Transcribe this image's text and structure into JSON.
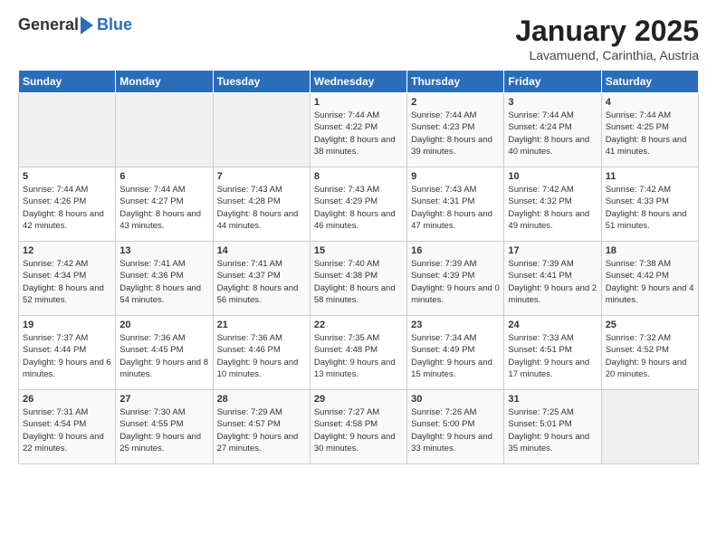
{
  "header": {
    "logo_general": "General",
    "logo_blue": "Blue",
    "title": "January 2025",
    "subtitle": "Lavamuend, Carinthia, Austria"
  },
  "calendar": {
    "headers": [
      "Sunday",
      "Monday",
      "Tuesday",
      "Wednesday",
      "Thursday",
      "Friday",
      "Saturday"
    ],
    "rows": [
      [
        {
          "day": "",
          "text": ""
        },
        {
          "day": "",
          "text": ""
        },
        {
          "day": "",
          "text": ""
        },
        {
          "day": "1",
          "text": "Sunrise: 7:44 AM\nSunset: 4:22 PM\nDaylight: 8 hours and 38 minutes."
        },
        {
          "day": "2",
          "text": "Sunrise: 7:44 AM\nSunset: 4:23 PM\nDaylight: 8 hours and 39 minutes."
        },
        {
          "day": "3",
          "text": "Sunrise: 7:44 AM\nSunset: 4:24 PM\nDaylight: 8 hours and 40 minutes."
        },
        {
          "day": "4",
          "text": "Sunrise: 7:44 AM\nSunset: 4:25 PM\nDaylight: 8 hours and 41 minutes."
        }
      ],
      [
        {
          "day": "5",
          "text": "Sunrise: 7:44 AM\nSunset: 4:26 PM\nDaylight: 8 hours and 42 minutes."
        },
        {
          "day": "6",
          "text": "Sunrise: 7:44 AM\nSunset: 4:27 PM\nDaylight: 8 hours and 43 minutes."
        },
        {
          "day": "7",
          "text": "Sunrise: 7:43 AM\nSunset: 4:28 PM\nDaylight: 8 hours and 44 minutes."
        },
        {
          "day": "8",
          "text": "Sunrise: 7:43 AM\nSunset: 4:29 PM\nDaylight: 8 hours and 46 minutes."
        },
        {
          "day": "9",
          "text": "Sunrise: 7:43 AM\nSunset: 4:31 PM\nDaylight: 8 hours and 47 minutes."
        },
        {
          "day": "10",
          "text": "Sunrise: 7:42 AM\nSunset: 4:32 PM\nDaylight: 8 hours and 49 minutes."
        },
        {
          "day": "11",
          "text": "Sunrise: 7:42 AM\nSunset: 4:33 PM\nDaylight: 8 hours and 51 minutes."
        }
      ],
      [
        {
          "day": "12",
          "text": "Sunrise: 7:42 AM\nSunset: 4:34 PM\nDaylight: 8 hours and 52 minutes."
        },
        {
          "day": "13",
          "text": "Sunrise: 7:41 AM\nSunset: 4:36 PM\nDaylight: 8 hours and 54 minutes."
        },
        {
          "day": "14",
          "text": "Sunrise: 7:41 AM\nSunset: 4:37 PM\nDaylight: 8 hours and 56 minutes."
        },
        {
          "day": "15",
          "text": "Sunrise: 7:40 AM\nSunset: 4:38 PM\nDaylight: 8 hours and 58 minutes."
        },
        {
          "day": "16",
          "text": "Sunrise: 7:39 AM\nSunset: 4:39 PM\nDaylight: 9 hours and 0 minutes."
        },
        {
          "day": "17",
          "text": "Sunrise: 7:39 AM\nSunset: 4:41 PM\nDaylight: 9 hours and 2 minutes."
        },
        {
          "day": "18",
          "text": "Sunrise: 7:38 AM\nSunset: 4:42 PM\nDaylight: 9 hours and 4 minutes."
        }
      ],
      [
        {
          "day": "19",
          "text": "Sunrise: 7:37 AM\nSunset: 4:44 PM\nDaylight: 9 hours and 6 minutes."
        },
        {
          "day": "20",
          "text": "Sunrise: 7:36 AM\nSunset: 4:45 PM\nDaylight: 9 hours and 8 minutes."
        },
        {
          "day": "21",
          "text": "Sunrise: 7:36 AM\nSunset: 4:46 PM\nDaylight: 9 hours and 10 minutes."
        },
        {
          "day": "22",
          "text": "Sunrise: 7:35 AM\nSunset: 4:48 PM\nDaylight: 9 hours and 13 minutes."
        },
        {
          "day": "23",
          "text": "Sunrise: 7:34 AM\nSunset: 4:49 PM\nDaylight: 9 hours and 15 minutes."
        },
        {
          "day": "24",
          "text": "Sunrise: 7:33 AM\nSunset: 4:51 PM\nDaylight: 9 hours and 17 minutes."
        },
        {
          "day": "25",
          "text": "Sunrise: 7:32 AM\nSunset: 4:52 PM\nDaylight: 9 hours and 20 minutes."
        }
      ],
      [
        {
          "day": "26",
          "text": "Sunrise: 7:31 AM\nSunset: 4:54 PM\nDaylight: 9 hours and 22 minutes."
        },
        {
          "day": "27",
          "text": "Sunrise: 7:30 AM\nSunset: 4:55 PM\nDaylight: 9 hours and 25 minutes."
        },
        {
          "day": "28",
          "text": "Sunrise: 7:29 AM\nSunset: 4:57 PM\nDaylight: 9 hours and 27 minutes."
        },
        {
          "day": "29",
          "text": "Sunrise: 7:27 AM\nSunset: 4:58 PM\nDaylight: 9 hours and 30 minutes."
        },
        {
          "day": "30",
          "text": "Sunrise: 7:26 AM\nSunset: 5:00 PM\nDaylight: 9 hours and 33 minutes."
        },
        {
          "day": "31",
          "text": "Sunrise: 7:25 AM\nSunset: 5:01 PM\nDaylight: 9 hours and 35 minutes."
        },
        {
          "day": "",
          "text": ""
        }
      ]
    ]
  }
}
